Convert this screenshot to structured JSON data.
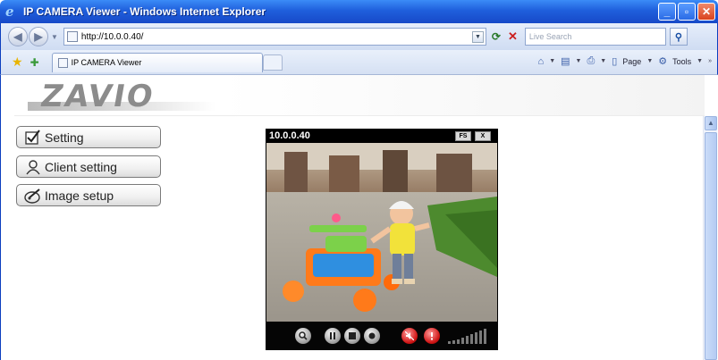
{
  "window": {
    "title": "IP CAMERA Viewer - Windows Internet Explorer"
  },
  "address_bar": {
    "url": "http://10.0.0.40/",
    "search_placeholder": "Live Search"
  },
  "tab": {
    "title": "IP CAMERA Viewer"
  },
  "commands": {
    "page_label": "Page",
    "tools_label": "Tools"
  },
  "logo": {
    "text": "ZAVIO"
  },
  "menu": [
    {
      "label": "Setting",
      "icon": "checkbox-icon"
    },
    {
      "label": "Client setting",
      "icon": "user-icon"
    },
    {
      "label": "Image setup",
      "icon": "image-edit-icon"
    }
  ],
  "video": {
    "ip": "10.0.0.40",
    "btn_fullscreen": "FS",
    "btn_exit": "X",
    "controls": [
      "zoom-icon",
      "pause-icon",
      "stop-icon",
      "record-icon",
      "mute-icon",
      "alarm-icon",
      "volume-icon"
    ]
  },
  "colors": {
    "titlebar": "#1f5fdc",
    "accent_red": "#d01515"
  }
}
